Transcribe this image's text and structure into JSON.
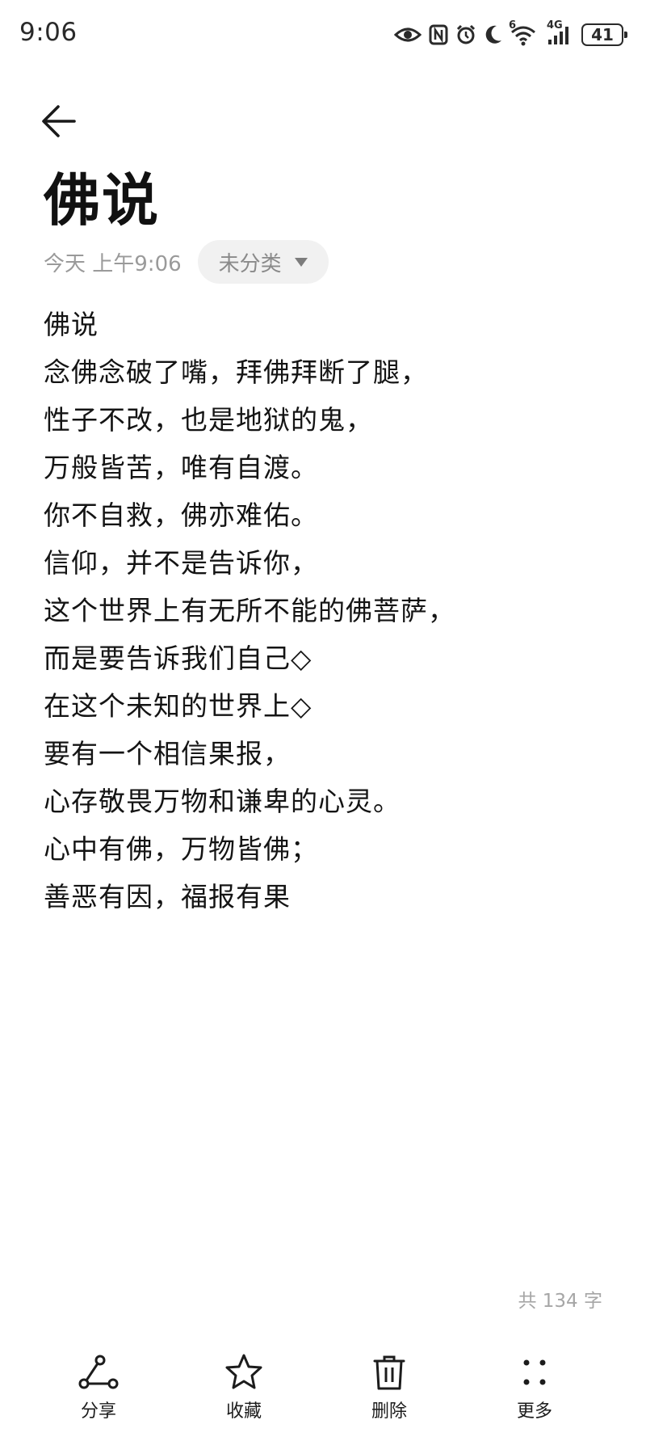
{
  "status_bar": {
    "time": "9:06",
    "network": "4G",
    "wifi_badge": "6",
    "battery": "41",
    "icons": [
      "eye-icon",
      "nfc-icon",
      "alarm-icon",
      "moon-icon",
      "wifi-icon",
      "signal-icon",
      "battery-icon"
    ]
  },
  "note": {
    "title": "佛说",
    "date": "今天 上午9:06",
    "category": "未分类",
    "lines": [
      "佛说",
      "念佛念破了嘴，拜佛拜断了腿，",
      "性子不改，也是地狱的鬼，",
      "万般皆苦，唯有自渡。",
      "你不自救，佛亦难佑。",
      "信仰，并不是告诉你，",
      "这个世界上有无所不能的佛菩萨，",
      "而是要告诉我们自己◇",
      "在这个未知的世界上◇",
      "要有一个相信果报，",
      "心存敬畏万物和谦卑的心灵。",
      "心中有佛，万物皆佛；",
      "善恶有因，福报有果"
    ],
    "word_count": "共 134 字"
  },
  "toolbar": {
    "share": "分享",
    "favorite": "收藏",
    "delete": "删除",
    "more": "更多"
  }
}
